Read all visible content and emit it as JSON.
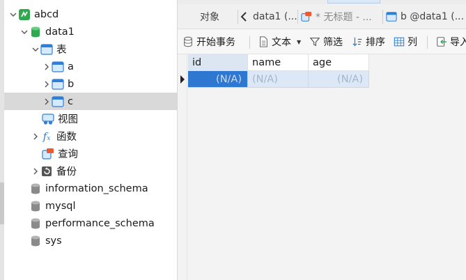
{
  "tree": {
    "connection": "abcd",
    "database": "data1",
    "tables_folder": "表",
    "tables": [
      "a",
      "b",
      "c"
    ],
    "views": "视图",
    "functions": "函数",
    "queries": "查询",
    "backups": "备份",
    "other_databases": [
      "information_schema",
      "mysql",
      "performance_schema",
      "sys"
    ]
  },
  "tabs": {
    "objects": "对象",
    "tab1": "data1 (...",
    "tab2": "* 无标题 - ...",
    "tab3": "b @data1 (..."
  },
  "toolbar": {
    "begin_transaction": "开始事务",
    "text": "文本",
    "filter": "筛选",
    "sort": "排序",
    "columns": "列",
    "import": "导入"
  },
  "grid": {
    "columns": [
      "id",
      "name",
      "age"
    ],
    "row": [
      "(N/A)",
      "(N/A)",
      "(N/A)"
    ]
  },
  "colors": {
    "selection": "#2e78d2",
    "row_highlight": "#dce8f5",
    "db_icon_green": "#2fa84f",
    "table_icon_blue": "#2f7fd6"
  }
}
